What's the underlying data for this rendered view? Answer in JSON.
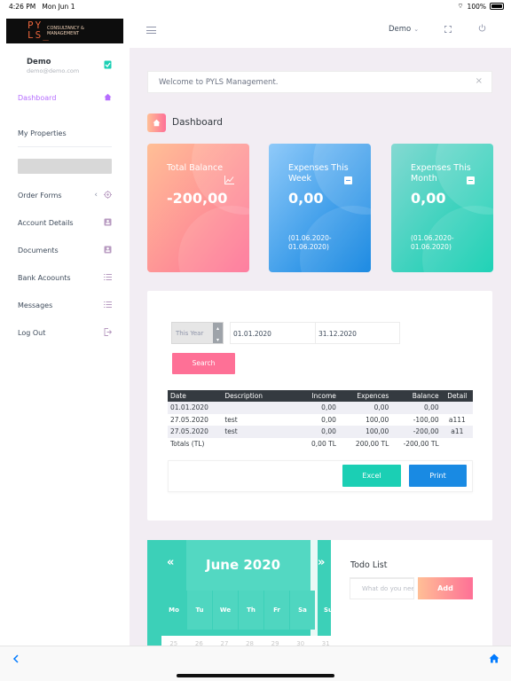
{
  "statusbar": {
    "time": "4:26 PM",
    "date": "Mon Jun 1",
    "battery": "100%"
  },
  "logo": {
    "big": "PY\nLS",
    "small": "CONSULTANCY &\nMANAGEMENT"
  },
  "profile": {
    "name": "Demo",
    "email": "demo@demo.com"
  },
  "sidebar": {
    "items": [
      {
        "label": "Dashboard",
        "icon": "home-icon"
      },
      {
        "label": "My Properties"
      },
      {
        "label": "Order Forms",
        "icon": "target-icon"
      },
      {
        "label": "Account Details",
        "icon": "id-card-icon"
      },
      {
        "label": "Documents",
        "icon": "id-card-icon"
      },
      {
        "label": "Bank Acoounts",
        "icon": "list-icon"
      },
      {
        "label": "Messages",
        "icon": "list-icon"
      },
      {
        "label": "Log Out",
        "icon": "logout-icon"
      }
    ]
  },
  "topnav": {
    "user": "Demo"
  },
  "welcome": {
    "text": "Welcome to PYLS Management."
  },
  "page": {
    "title": "Dashboard"
  },
  "cards": [
    {
      "title": "Total Balance",
      "value": "-200,00",
      "sub": ""
    },
    {
      "title": "Expenses This Week",
      "value": "0,00",
      "sub": "(01.06.2020-\n01.06.2020)"
    },
    {
      "title": "Expenses This Month",
      "value": "0,00",
      "sub": "(01.06.2020-\n01.06.2020)"
    }
  ],
  "filter": {
    "period": "This Year",
    "from": "01.01.2020",
    "to": "31.12.2020",
    "search_label": "Search"
  },
  "table": {
    "headers": [
      "Date",
      "Description",
      "Income",
      "Expences",
      "Balance",
      "Detail"
    ],
    "rows": [
      [
        "01.01.2020",
        "",
        "0,00",
        "0,00",
        "0,00",
        ""
      ],
      [
        "27.05.2020",
        "test",
        "0,00",
        "100,00",
        "-100,00",
        "a111"
      ],
      [
        "27.05.2020",
        "test",
        "0,00",
        "100,00",
        "-200,00",
        "a11"
      ]
    ],
    "totals": [
      "Totals (TL)",
      "",
      "0,00 TL",
      "200,00 TL",
      "-200,00 TL",
      ""
    ]
  },
  "buttons": {
    "excel": "Excel",
    "print": "Print"
  },
  "calendar": {
    "prev": "«",
    "next": "»",
    "month": "June 2020",
    "days": [
      "Mo",
      "Tu",
      "We",
      "Th",
      "Fr",
      "Sa",
      "Su"
    ],
    "dates": [
      "25",
      "26",
      "27",
      "28",
      "29",
      "30",
      "31"
    ]
  },
  "todo": {
    "title": "Todo List",
    "placeholder": "What do you need",
    "add_label": "Add"
  },
  "colors": {
    "accent": "#b66dff",
    "pink": "#fe7096",
    "blue": "#198ae3",
    "teal": "#1bcfb4"
  }
}
